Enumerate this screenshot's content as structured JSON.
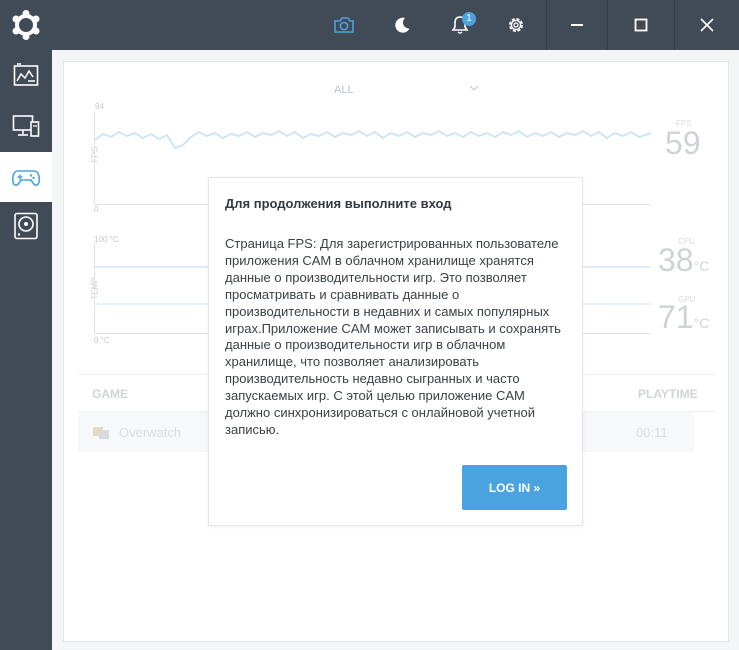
{
  "topbar": {
    "notification_count": "1"
  },
  "fps_graph": {
    "max_tick": "94",
    "min_tick": "0",
    "axis_name": "FPS",
    "caption": "FPS",
    "value": "59"
  },
  "temp_graph": {
    "max_tick": "100 °C",
    "min_tick": "0 °C",
    "axis_name": "TEMP",
    "cpu_caption": "CPU",
    "cpu_value": "38",
    "gpu_caption": "GPU",
    "gpu_value": "71",
    "unit": "°C"
  },
  "filter": {
    "selected": "ALL"
  },
  "table": {
    "col_game": "GAME",
    "col_playtime": "PLAYTIME",
    "rows": [
      {
        "game": "Overwatch",
        "playtime": "00:11"
      }
    ]
  },
  "modal": {
    "title": "Для продолжения выполните вход",
    "body": "Страница FPS: Для зарегистрированных пользователе приложения CAM в облачном хранилище хранятся данные о производительности игр. Это позволяет просматривать и сравнивать данные о производительности в недавних и самых популярных играх.Приложение CAM может записывать и сохранять данные о производительности игр в облачном хранилище, что позволяет анализировать производительность недавно сыгранных и часто запускаемых игр. С этой целью приложение CAM должно синхронизироваться с онлайновой учетной записью.",
    "login_label": "LOG IN »"
  },
  "colors": {
    "chrome": "#414a57",
    "accent": "#4aa3df"
  }
}
